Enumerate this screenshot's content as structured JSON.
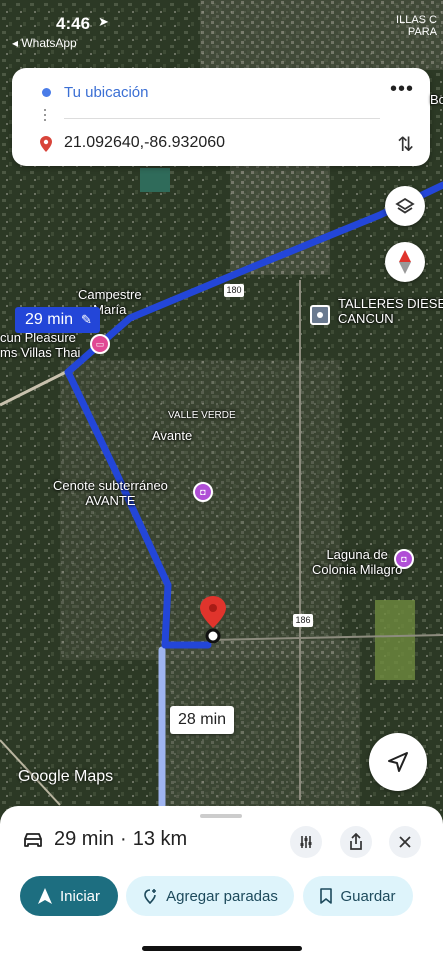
{
  "status_bar": {
    "time": "4:46",
    "back_app": "◂ WhatsApp",
    "top_right_text": "ILLAS C\nPARA"
  },
  "route_card": {
    "origin": "Tu ubicación",
    "destination": "21.092640,-86.932060"
  },
  "map": {
    "route_time_label": "29 min",
    "alt_route_label": "28 min",
    "attribution": "Google Maps",
    "labels": {
      "campestre": "Campestre\nMaría",
      "pleasure": "cun Pleasure\nms Villas Thai",
      "talleres": "TALLERES DIESE\nCANCUN",
      "valle_verde": "VALLE VERDE",
      "avante": "Avante",
      "cenote": "Cenote subterráneo\nAVANTE",
      "laguna": "Laguna de\nColonia Milagro",
      "road_180": "180",
      "road_186": "186",
      "edge_bo": "Bo"
    }
  },
  "bottom_sheet": {
    "summary_time": "29 min",
    "summary_sep": "·",
    "summary_distance": "13 km",
    "start_label": "Iniciar",
    "add_stops_label": "Agregar paradas",
    "save_label": "Guardar"
  },
  "colors": {
    "route": "#2346d8",
    "alt_route": "#9fb4f0",
    "start_button": "#1d6e80",
    "pill_bg": "#def4fb"
  }
}
